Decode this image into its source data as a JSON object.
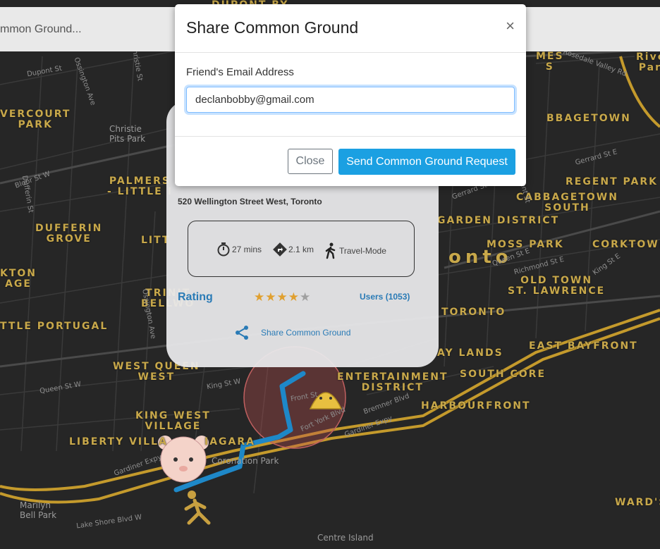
{
  "search": {
    "text": "mmon Ground..."
  },
  "map": {
    "areas": [
      "DUPONT BY",
      "VERCOURT\nPARK",
      "Christie\nPits Park",
      "PALMERS\n- LITTLE I",
      "DUFFERIN\nGROVE",
      "LITT",
      "KTON\nAGE",
      "TRINIT\nBELLWO",
      "TTLE PORTUGAL",
      "WEST QUEEN\nWEST",
      "KING WEST\nVILLAGE",
      "LIBERTY VILLA",
      "IAGARA",
      "Coronation Park",
      "Marilyn\nBell Park",
      "Centre Island",
      "MES\nS",
      "BBAGETOWN",
      "REGENT PARK",
      "CABBAGETOWN\nSOUTH",
      "GARDEN DISTRICT",
      "MOSS PARK",
      "CORKTOWN",
      "onto",
      "OLD TOWN\nST. LAWRENCE",
      "TORONTO",
      "AY LANDS",
      "EAST BAYFRONT",
      "ENTERTAINMENT\nDISTRICT",
      "SOUTH CORE",
      "HARBOURFRONT",
      "WARD'S",
      "River\nPark"
    ],
    "streets": [
      "Dupont St",
      "Christie St",
      "Ossington Ave",
      "Bloor St W",
      "Dufferin St",
      "Ossington Ave",
      "Queen St W",
      "King St W",
      "Gardiner Expy",
      "Lake Shore Blvd W",
      "Rosedale Valley Rd",
      "Gerrard St E",
      "Queen St E",
      "Richmond St E",
      "King St E",
      "Bremner Blvd",
      "Fort York Blvd",
      "Front St",
      "Gardiner Expy",
      "Gerrard St",
      "Parliament St"
    ]
  },
  "card": {
    "address": "520 Wellington Street West, Toronto",
    "duration": "27 mins",
    "distance": "2.1 km",
    "travel_mode": "Travel-Mode",
    "rating_label": "Rating",
    "rating_value": 4,
    "rating_max": 5,
    "users": "Users (1053)",
    "share_label": "Share Common Ground"
  },
  "modal": {
    "title": "Share Common Ground",
    "close_symbol": "×",
    "email_label": "Friend's Email Address",
    "email_value": "declanbobby@gmail.com",
    "close_button": "Close",
    "send_button": "Send Common Ground Request"
  },
  "colors": {
    "map_bg": "#262626",
    "road_major": "#c49a2c",
    "route": "#1e88c8",
    "label": "#c8a84a",
    "primary": "#1ba0e2",
    "link": "#2a7bb6"
  },
  "icons": {
    "close": "close-icon",
    "timer": "stopwatch-icon",
    "distance": "directions-icon",
    "mode": "walking-icon",
    "share": "share-icon",
    "user_marker": "bear-avatar-icon",
    "dest_marker": "taco-icon",
    "walker": "walking-person-icon"
  }
}
